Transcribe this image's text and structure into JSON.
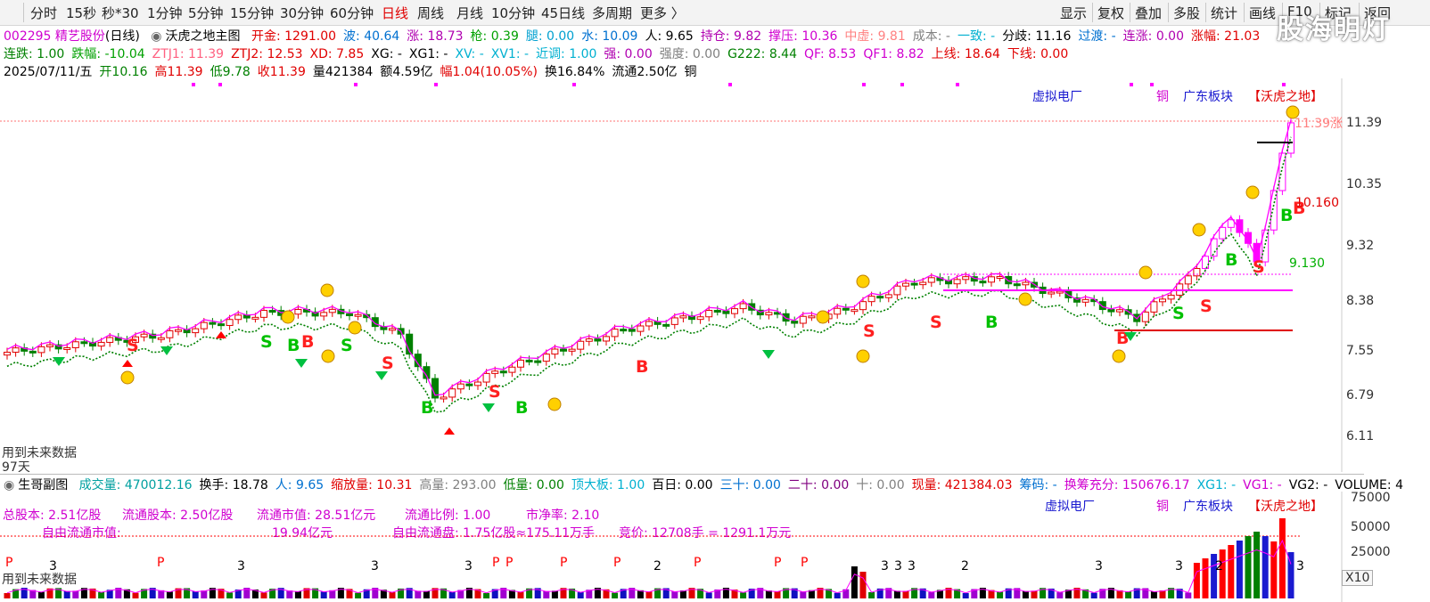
{
  "toolbar": {
    "left_tabs": [
      "分时",
      "15秒",
      "秒*30",
      "1分钟",
      "5分钟",
      "15分钟",
      "30分钟",
      "60分钟",
      "日线",
      "周线",
      "月线",
      "10分钟",
      "45日线",
      "多周期",
      "更多 〉"
    ],
    "active_tab": "日线",
    "right_tabs": [
      "显示",
      "复权",
      "叠加",
      "多股",
      "统计",
      "画线",
      "F10",
      "标记",
      "返回"
    ],
    "watermark": "股海明灯"
  },
  "main": {
    "row1": {
      "code": "002295 精艺股份",
      "period": "(日线)",
      "indicator": "沃虎之地主图",
      "items": [
        {
          "t": "开金: 1291.00",
          "c": "#e00000"
        },
        {
          "t": "波: 40.64",
          "c": "#0070d0"
        },
        {
          "t": "涨: 18.73",
          "c": "#b000b0"
        },
        {
          "t": "枪: 0.39",
          "c": "#00a000"
        },
        {
          "t": "腿: 0.00",
          "c": "#00a0d0"
        },
        {
          "t": "水: 10.09",
          "c": "#0070d0"
        },
        {
          "t": "人: 9.65",
          "c": "#000000"
        },
        {
          "t": "持仓: 9.82",
          "c": "#b000b0"
        },
        {
          "t": "撑压: 10.36",
          "c": "#d000d0"
        },
        {
          "t": "中虚: 9.81",
          "c": "#ff8080"
        },
        {
          "t": "成本: -",
          "c": "#808080"
        },
        {
          "t": "一致: -",
          "c": "#00b0d0"
        },
        {
          "t": "分歧: 11.16",
          "c": "#000000"
        },
        {
          "t": "过渡: -",
          "c": "#0070d0"
        },
        {
          "t": "连涨: 0.00",
          "c": "#b000b0"
        },
        {
          "t": "涨幅: 21.03",
          "c": "#e00000"
        }
      ]
    },
    "row2": [
      {
        "t": "连跌: 1.00",
        "c": "#008000"
      },
      {
        "t": "跌幅: -10.04",
        "c": "#00a000"
      },
      {
        "t": "ZTJ1: 11.39",
        "c": "#ff6080"
      },
      {
        "t": "ZTJ2: 12.53",
        "c": "#e00000"
      },
      {
        "t": "XD: 7.85",
        "c": "#e00000"
      },
      {
        "t": "XG: -",
        "c": "#000000"
      },
      {
        "t": "XG1: -",
        "c": "#000000"
      },
      {
        "t": "XV: -",
        "c": "#00b0d0"
      },
      {
        "t": "XV1: -",
        "c": "#00b0d0"
      },
      {
        "t": "近调: 1.00",
        "c": "#00b0d0"
      },
      {
        "t": "强: 0.00",
        "c": "#b000b0"
      },
      {
        "t": "强度: 0.00",
        "c": "#808080"
      },
      {
        "t": "G222: 8.44",
        "c": "#008000"
      },
      {
        "t": "QF: 8.53",
        "c": "#d000d0"
      },
      {
        "t": "QF1: 8.82",
        "c": "#d000d0"
      },
      {
        "t": "上线: 18.64",
        "c": "#e00000"
      },
      {
        "t": "下线: 0.00",
        "c": "#e00000"
      }
    ],
    "row3": [
      {
        "t": "2025/07/11/五",
        "c": "#000000"
      },
      {
        "t": "开10.16",
        "c": "#008000"
      },
      {
        "t": "高11.39",
        "c": "#e00000"
      },
      {
        "t": "低9.78",
        "c": "#008000"
      },
      {
        "t": "收11.39",
        "c": "#e00000"
      },
      {
        "t": "量421384",
        "c": "#000000"
      },
      {
        "t": "额4.59亿",
        "c": "#000000"
      },
      {
        "t": "幅1.04(10.05%)",
        "c": "#e00000"
      },
      {
        "t": "换16.84%",
        "c": "#000000"
      },
      {
        "t": "流通2.50亿",
        "c": "#000000"
      },
      {
        "t": "铜",
        "c": "#000000"
      }
    ],
    "y_ticks": [
      "11.39",
      "10.35",
      "9.32",
      "8.38",
      "7.55",
      "6.79",
      "6.11"
    ],
    "tags": {
      "t1": "虚拟电厂",
      "t2": "铜",
      "t3": "广东板块",
      "t4": "【沃虎之地】"
    },
    "price_tag_top": "11.39涨",
    "price_tag_mid": "10.160",
    "price_tag_low": "9.130",
    "future_note": "用到未来数据",
    "days_note": "97天",
    "signals": [
      "S",
      "B",
      "B",
      "S",
      "S",
      "B",
      "S",
      "B",
      "B",
      "S",
      "S",
      "B",
      "B",
      "S",
      "S",
      "B",
      "S",
      "B",
      "B",
      "S"
    ]
  },
  "sub": {
    "row1": {
      "title": "生哥副图",
      "items": [
        {
          "t": "成交量: 470012.16",
          "c": "#00a0a0"
        },
        {
          "t": "换手: 18.78",
          "c": "#000000"
        },
        {
          "t": "人: 9.65",
          "c": "#0070d0"
        },
        {
          "t": "缩放量: 10.31",
          "c": "#e00000"
        },
        {
          "t": "高量: 293.00",
          "c": "#808080"
        },
        {
          "t": "低量: 0.00",
          "c": "#008000"
        },
        {
          "t": "顶大板: 1.00",
          "c": "#00b0d0"
        },
        {
          "t": "百日: 0.00",
          "c": "#000000"
        },
        {
          "t": "三十: 0.00",
          "c": "#0070d0"
        },
        {
          "t": "二十: 0.00",
          "c": "#800080"
        },
        {
          "t": "十: 0.00",
          "c": "#808080"
        },
        {
          "t": "现量: 421384.03",
          "c": "#e00000"
        },
        {
          "t": "筹码: -",
          "c": "#0070d0"
        },
        {
          "t": "换筹充分: 150676.17",
          "c": "#d000d0"
        },
        {
          "t": "XG1: -",
          "c": "#00b0d0"
        },
        {
          "t": "VG1: -",
          "c": "#d000d0"
        },
        {
          "t": "VG2: -",
          "c": "#000000"
        },
        {
          "t": "VOLUME: 4",
          "c": "#000000"
        }
      ]
    },
    "info1": [
      {
        "t": "总股本:  2.51亿股"
      },
      {
        "t": "流通股本:  2.50亿股"
      },
      {
        "t": "流通市值:   28.51亿元"
      },
      {
        "t": "流通比例:  1.00"
      },
      {
        "t": "市净率:  2.10"
      }
    ],
    "info2": [
      {
        "t": "自由流通市值:"
      },
      {
        "t": "19.94亿元"
      },
      {
        "t": "自由流通盘:  1.75亿股≈175.11万手"
      },
      {
        "t": "竞价:  12708手 = 1291.1万元"
      }
    ],
    "y_ticks": [
      "75000",
      "50000",
      "25000"
    ],
    "scale": "X10",
    "future_note": "用到未来数据",
    "markers": [
      "P",
      "3",
      "P",
      "3",
      "3",
      "3",
      "P",
      "P",
      "P",
      "P",
      "2",
      "P",
      "P",
      "P",
      "3",
      "3",
      "3",
      "2",
      "3",
      "3",
      "2",
      "3"
    ]
  },
  "colors": {
    "up": "#e00000",
    "down": "#008000",
    "ma": "#ff00ff",
    "dotted": "#008000",
    "limitup": "#ff00ff"
  }
}
